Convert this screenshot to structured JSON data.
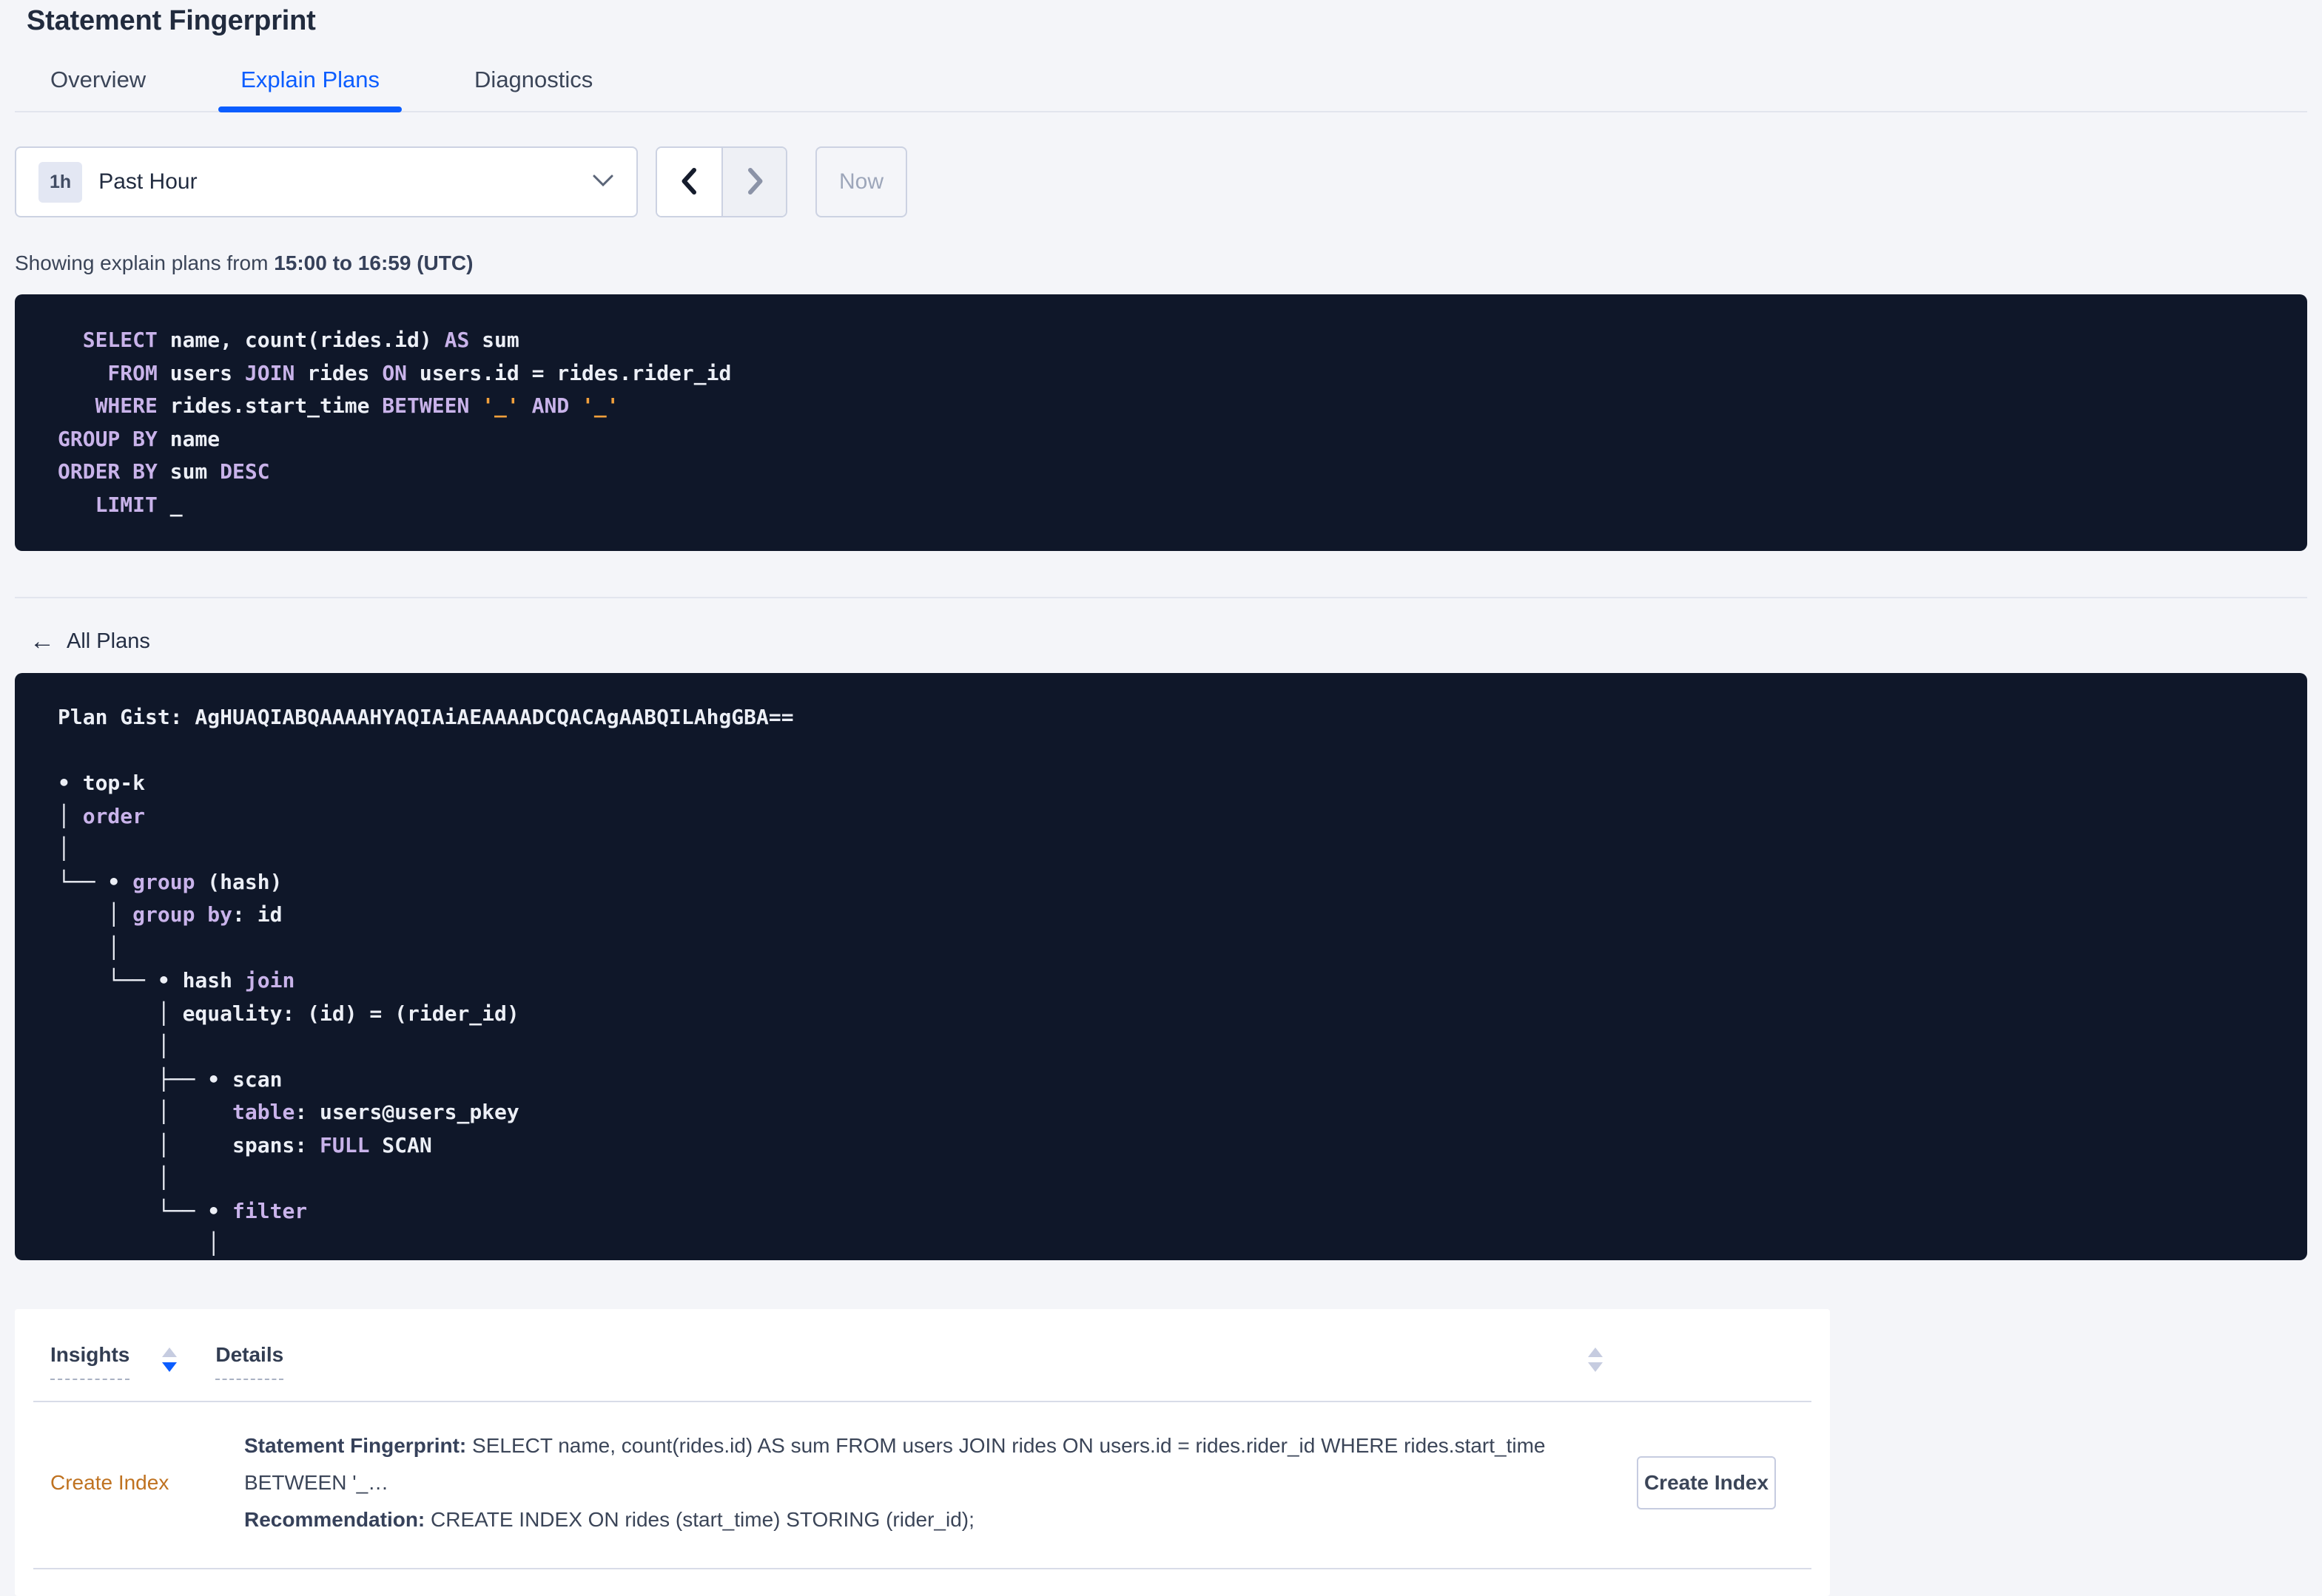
{
  "header": {
    "title": "Statement Fingerprint"
  },
  "tabs": [
    {
      "label": "Overview",
      "active": false
    },
    {
      "label": "Explain Plans",
      "active": true
    },
    {
      "label": "Diagnostics",
      "active": false
    }
  ],
  "time_picker": {
    "badge": "1h",
    "selected": "Past Hour",
    "now_label": "Now"
  },
  "showing": {
    "prefix": "Showing explain plans from ",
    "range": "15:00 to 16:59 (UTC)"
  },
  "sql_block": {
    "lines": [
      {
        "segs": [
          {
            "c": "kw",
            "s": "  SELECT"
          },
          {
            "c": "pl",
            "s": " name, count(rides.id) "
          },
          {
            "c": "kw",
            "s": "AS"
          },
          {
            "c": "pl",
            "s": " sum"
          }
        ]
      },
      {
        "segs": [
          {
            "c": "kw",
            "s": "    FROM"
          },
          {
            "c": "pl",
            "s": " users "
          },
          {
            "c": "kw",
            "s": "JOIN"
          },
          {
            "c": "pl",
            "s": " rides "
          },
          {
            "c": "kw",
            "s": "ON"
          },
          {
            "c": "pl",
            "s": " users.id = rides.rider_id"
          }
        ]
      },
      {
        "segs": [
          {
            "c": "kw",
            "s": "   WHERE"
          },
          {
            "c": "pl",
            "s": " rides.start_time "
          },
          {
            "c": "kw",
            "s": "BETWEEN"
          },
          {
            "c": "pl",
            "s": " "
          },
          {
            "c": "str",
            "s": "'_'"
          },
          {
            "c": "pl",
            "s": " "
          },
          {
            "c": "kw",
            "s": "AND"
          },
          {
            "c": "pl",
            "s": " "
          },
          {
            "c": "str",
            "s": "'_'"
          }
        ]
      },
      {
        "segs": [
          {
            "c": "kw",
            "s": "GROUP BY"
          },
          {
            "c": "pl",
            "s": " name"
          }
        ]
      },
      {
        "segs": [
          {
            "c": "kw",
            "s": "ORDER BY"
          },
          {
            "c": "pl",
            "s": " sum "
          },
          {
            "c": "kw",
            "s": "DESC"
          }
        ]
      },
      {
        "segs": [
          {
            "c": "kw",
            "s": "   LIMIT"
          },
          {
            "c": "pl",
            "s": " _"
          }
        ]
      }
    ]
  },
  "all_plans": {
    "back_icon": "←",
    "label": "All Plans"
  },
  "gist_block": {
    "lines": [
      {
        "segs": [
          {
            "c": "pl",
            "s": "Plan Gist: AgHUAQIABQAAAAHYAQIAiAEAAAADCQACAgAABQILAhgGBA=="
          }
        ]
      },
      {
        "segs": []
      },
      {
        "segs": [
          {
            "c": "pl",
            "s": "• top-k"
          }
        ]
      },
      {
        "segs": [
          {
            "c": "pl",
            "s": "│ "
          },
          {
            "c": "kw",
            "s": "order"
          }
        ]
      },
      {
        "segs": [
          {
            "c": "pl",
            "s": "│"
          }
        ]
      },
      {
        "segs": [
          {
            "c": "pl",
            "s": "└── • "
          },
          {
            "c": "kw",
            "s": "group"
          },
          {
            "c": "pl",
            "s": " (hash)"
          }
        ]
      },
      {
        "segs": [
          {
            "c": "pl",
            "s": "    │ "
          },
          {
            "c": "kw",
            "s": "group by"
          },
          {
            "c": "pl",
            "s": ": id"
          }
        ]
      },
      {
        "segs": [
          {
            "c": "pl",
            "s": "    │"
          }
        ]
      },
      {
        "segs": [
          {
            "c": "pl",
            "s": "    └── • hash "
          },
          {
            "c": "kw",
            "s": "join"
          }
        ]
      },
      {
        "segs": [
          {
            "c": "pl",
            "s": "        │ equality: (id) = (rider_id)"
          }
        ]
      },
      {
        "segs": [
          {
            "c": "pl",
            "s": "        │"
          }
        ]
      },
      {
        "segs": [
          {
            "c": "pl",
            "s": "        ├── • scan"
          }
        ]
      },
      {
        "segs": [
          {
            "c": "pl",
            "s": "        │     "
          },
          {
            "c": "kw",
            "s": "table"
          },
          {
            "c": "pl",
            "s": ": users@users_pkey"
          }
        ]
      },
      {
        "segs": [
          {
            "c": "pl",
            "s": "        │     spans: "
          },
          {
            "c": "kw",
            "s": "FULL"
          },
          {
            "c": "pl",
            "s": " SCAN"
          }
        ]
      },
      {
        "segs": [
          {
            "c": "pl",
            "s": "        │"
          }
        ]
      },
      {
        "segs": [
          {
            "c": "pl",
            "s": "        └── • "
          },
          {
            "c": "kw",
            "s": "filter"
          }
        ]
      },
      {
        "segs": [
          {
            "c": "pl",
            "s": "            │"
          }
        ]
      }
    ]
  },
  "insights_table": {
    "columns": [
      {
        "label": "Insights",
        "sort": "desc"
      },
      {
        "label": "Details",
        "sort": "none"
      }
    ],
    "row": {
      "insight": "Create Index",
      "fingerprint_label": "Statement Fingerprint:",
      "fingerprint_text": " SELECT name, count(rides.id) AS sum FROM users JOIN rides ON users.id = rides.rider_id WHERE rides.start_time BETWEEN '_…",
      "recommendation_label": "Recommendation:",
      "recommendation_text": " CREATE INDEX ON rides (start_time) STORING (rider_id);",
      "button_label": "Create Index"
    }
  },
  "colors": {
    "accent_blue": "#0b5dff",
    "code_bg": "#0f1729",
    "code_keyword": "#c9b3ea",
    "code_literal": "#f2a03c",
    "code_text": "#eceff6",
    "insight_link_orange": "#bf7220",
    "page_bg": "#f4f5f9"
  }
}
